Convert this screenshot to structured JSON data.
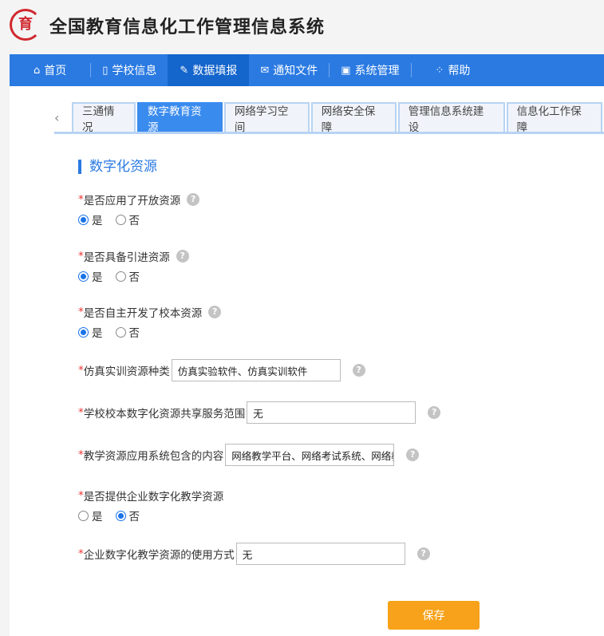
{
  "app": {
    "title": "全国教育信息化工作管理信息系统",
    "logo_text": "育"
  },
  "nav": [
    {
      "label": "首页",
      "icon": "⌂"
    },
    {
      "label": "学校信息",
      "icon": "▯"
    },
    {
      "label": "数据填报",
      "icon": "✎"
    },
    {
      "label": "通知文件",
      "icon": "✉"
    },
    {
      "label": "系统管理",
      "icon": "▣"
    },
    {
      "label": "帮助",
      "icon": "⁘"
    }
  ],
  "tabs": [
    "三通情况",
    "数字教育资源",
    "网络学习空间",
    "网络安全保障",
    "管理信息系统建设",
    "信息化工作保障"
  ],
  "active_tab": 1,
  "section_title": "数字化资源",
  "required_mark": "*",
  "help_glyph": "?",
  "yes": "是",
  "no": "否",
  "questions": [
    {
      "label": "是否应用了开放资源",
      "type": "radio",
      "value": "是"
    },
    {
      "label": "是否具备引进资源",
      "type": "radio",
      "value": "是"
    },
    {
      "label": "是否自主开发了校本资源",
      "type": "radio",
      "value": "是"
    },
    {
      "label": "仿真实训资源种类",
      "type": "text",
      "value": "仿真实验软件、仿真实训软件"
    },
    {
      "label": "学校校本数字化资源共享服务范围",
      "type": "text",
      "value": "无"
    },
    {
      "label": "教学资源应用系统包含的内容",
      "type": "text",
      "value": "网络教学平台、网络考试系统、网络教"
    },
    {
      "label": "是否提供企业数字化教学资源",
      "type": "radio",
      "value": "否"
    },
    {
      "label": "企业数字化教学资源的使用方式",
      "type": "text",
      "value": "无"
    }
  ],
  "save_label": "保存"
}
